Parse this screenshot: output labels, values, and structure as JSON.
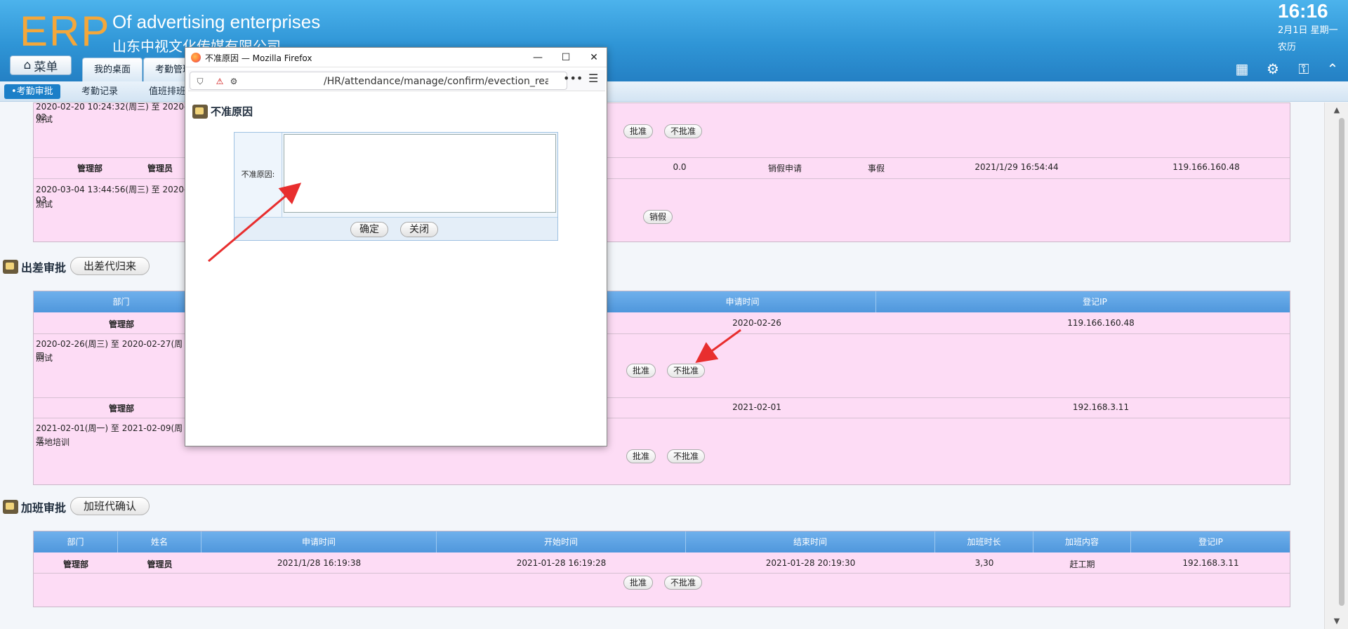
{
  "header": {
    "logo": "ERP",
    "company_en": "Of advertising enterprises",
    "company_cn": "山东中视文化传媒有限公司",
    "menu_label": "菜单",
    "tabs": [
      {
        "label": "我的桌面"
      },
      {
        "label": "考勤管理"
      }
    ],
    "clock": "16:16",
    "date": "2月1日 星期一",
    "lunar": "农历"
  },
  "subtabs": [
    {
      "label": "•考勤审批"
    },
    {
      "label": "考勤记录"
    },
    {
      "label": "值班排班"
    }
  ],
  "leave_section": {
    "row1": {
      "time_range": "2020-02-20 10:24:32(周三) 至 2020-02",
      "note": "测试",
      "approve": "批准",
      "reject": "不批准"
    },
    "row2": {
      "dept": "管理部",
      "name": "管理员",
      "duration": "0.0",
      "type": "销假申请",
      "leave_type": "事假",
      "apply_time": "2021/1/29 16:54:44",
      "ip": "119.166.160.48"
    },
    "row3": {
      "time_range": "2020-03-04 13:44:56(周三) 至 2020-03",
      "note": "测试",
      "cancel": "销假"
    }
  },
  "travel_section": {
    "title": "出差审批",
    "proxy_button": "出差代归来",
    "headers": [
      "部门",
      "申请时间",
      "登记IP"
    ],
    "rows": [
      {
        "dept": "管理部",
        "apply_time": "2020-02-26",
        "ip": "119.166.160.48",
        "time_range": "2020-02-26(周三) 至 2020-02-27(周四",
        "note": "测试",
        "approve": "批准",
        "reject": "不批准"
      },
      {
        "dept": "管理部",
        "apply_time": "2021-02-01",
        "ip": "192.168.3.11",
        "time_range": "2021-02-01(周一) 至 2021-02-09(周二",
        "note": "落地培训",
        "approve": "批准",
        "reject": "不批准"
      }
    ]
  },
  "overtime_section": {
    "title": "加班审批",
    "proxy_button": "加班代确认",
    "headers": [
      "部门",
      "姓名",
      "申请时间",
      "开始时间",
      "结束时间",
      "加班时长",
      "加班内容",
      "登记IP"
    ],
    "row": {
      "dept": "管理部",
      "name": "管理员",
      "apply_time": "2021/1/28 16:19:38",
      "start": "2021-01-28 16:19:28",
      "end": "2021-01-28 20:19:30",
      "hours": "3,30",
      "content": "赶工期",
      "ip": "192.168.3.11",
      "approve": "批准",
      "reject": "不批准"
    }
  },
  "popup": {
    "window_title": "不准原因 — Mozilla Firefox",
    "url": "/HR/attendance/manage/confirm/evection_reason",
    "dialog_title": "不准原因",
    "field_label": "不准原因:",
    "textarea_value": "",
    "ok": "确定",
    "close": "关闭"
  }
}
